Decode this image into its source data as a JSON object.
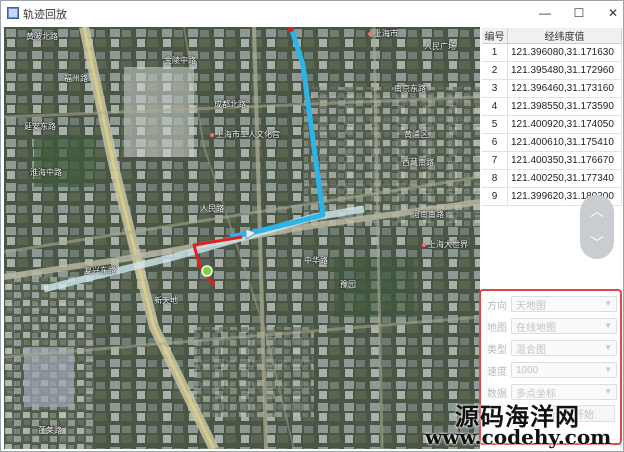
{
  "window": {
    "title": "轨迹回放",
    "minimize": "—",
    "maximize": "☐",
    "close": "✕"
  },
  "map": {
    "route_blue_color": "#2ab4e8",
    "route_red_color": "#e02020",
    "marker_color": "#7dd33a",
    "labels": [
      {
        "text": "黄陂北路",
        "pin": false
      },
      {
        "text": "上海市",
        "pin": true
      },
      {
        "text": "人民广场",
        "pin": false
      },
      {
        "text": "金陵中路",
        "pin": false
      },
      {
        "text": "福州路",
        "pin": false
      },
      {
        "text": "南京东路",
        "pin": false
      },
      {
        "text": "成都北路",
        "pin": false
      },
      {
        "text": "延安东路",
        "pin": false
      },
      {
        "text": "上海市工人文化宫",
        "pin": true
      },
      {
        "text": "黄浦区",
        "pin": false
      },
      {
        "text": "淮海中路",
        "pin": false
      },
      {
        "text": "西藏南路",
        "pin": false
      },
      {
        "text": "人民路",
        "pin": false
      },
      {
        "text": "河南南路",
        "pin": false
      },
      {
        "text": "复兴东路",
        "pin": false
      },
      {
        "text": "中华路",
        "pin": false
      },
      {
        "text": "上海大世界",
        "pin": true
      },
      {
        "text": "豫园",
        "pin": false
      },
      {
        "text": "新天地",
        "pin": false
      },
      {
        "text": "蓬莱路",
        "pin": false
      }
    ]
  },
  "table": {
    "header_id": "编号",
    "header_coord": "经纬度值",
    "rows": [
      {
        "id": "1",
        "coord": "121.396080,31.171630"
      },
      {
        "id": "2",
        "coord": "121.395480,31.172960"
      },
      {
        "id": "3",
        "coord": "121.396460,31.173160"
      },
      {
        "id": "4",
        "coord": "121.398550,31.173590"
      },
      {
        "id": "5",
        "coord": "121.400920,31.174050"
      },
      {
        "id": "6",
        "coord": "121.400610,31.175410"
      },
      {
        "id": "7",
        "coord": "121.400350,31.176670"
      },
      {
        "id": "8",
        "coord": "121.400250,31.177340"
      },
      {
        "id": "9",
        "coord": "121.399620,31.180300"
      }
    ]
  },
  "scroller": {
    "up": "︿",
    "down": "﹀"
  },
  "settings": {
    "rows": [
      {
        "label": "方向",
        "value": "天地图"
      },
      {
        "label": "地图",
        "value": "在线地图"
      },
      {
        "label": "类型",
        "value": "混合图"
      },
      {
        "label": "速度",
        "value": "1000"
      },
      {
        "label": "数据",
        "value": "多点坐标"
      }
    ],
    "button_label": "开始"
  },
  "watermark": {
    "cn": "源码海洋网",
    "url": "www.codehy.com"
  }
}
